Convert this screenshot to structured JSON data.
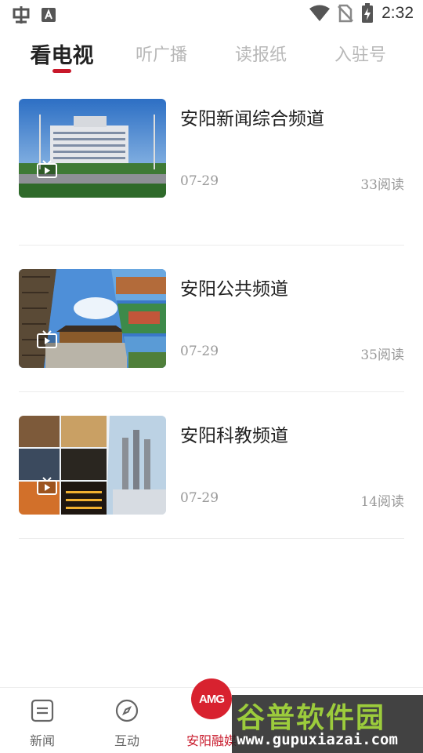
{
  "status_bar": {
    "time": "2:32",
    "left_icons": [
      "bug-app-icon",
      "font-a-icon"
    ],
    "right_icons": [
      "wifi-icon",
      "no-sim-icon",
      "battery-charging-icon"
    ]
  },
  "tabs": [
    {
      "label": "看电视",
      "active": true
    },
    {
      "label": "听广播",
      "active": false
    },
    {
      "label": "读报纸",
      "active": false
    },
    {
      "label": "入驻号",
      "active": false
    }
  ],
  "accent_color": "#c8182a",
  "channels": [
    {
      "title": "安阳新闻综合频道",
      "date": "07-29",
      "reads": "33阅读"
    },
    {
      "title": "安阳公共频道",
      "date": "07-29",
      "reads": "35阅读"
    },
    {
      "title": "安阳科教频道",
      "date": "07-29",
      "reads": "14阅读"
    }
  ],
  "bottom_nav": {
    "items": [
      {
        "label": "新闻",
        "icon": "news-list-icon"
      },
      {
        "label": "互动",
        "icon": "compass-icon"
      },
      {
        "label": "安阳融媒",
        "icon": "amg-logo"
      }
    ],
    "logo_text": "AMG"
  },
  "watermark": {
    "main": "谷普软件园",
    "url": "www.gupuxiazai.com"
  }
}
